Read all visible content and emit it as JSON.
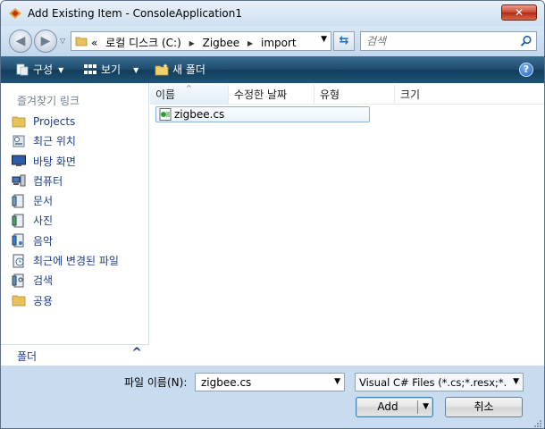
{
  "window": {
    "title": "Add Existing Item - ConsoleApplication1"
  },
  "titlebar": {
    "close_glyph": "✕"
  },
  "address": {
    "overflow": "«",
    "crumbs": [
      "로컬 디스크 (C:)",
      "Zigbee",
      "import"
    ]
  },
  "search": {
    "placeholder": "검색"
  },
  "toolbar": {
    "organize_label": "구성",
    "views_label": "보기",
    "new_folder_label": "새 폴더",
    "help_glyph": "?"
  },
  "nav_pane": {
    "header": "즐겨찾기 링크",
    "items": [
      {
        "label": "Projects",
        "icon": "folder-icon"
      },
      {
        "label": "최근 위치",
        "icon": "recent-places-icon"
      },
      {
        "label": "바탕 화면",
        "icon": "desktop-icon"
      },
      {
        "label": "컴퓨터",
        "icon": "computer-icon"
      },
      {
        "label": "문서",
        "icon": "documents-icon"
      },
      {
        "label": "사진",
        "icon": "pictures-icon"
      },
      {
        "label": "음악",
        "icon": "music-icon"
      },
      {
        "label": "최근에 변경된 파일",
        "icon": "recently-changed-icon"
      },
      {
        "label": "검색",
        "icon": "searches-icon"
      },
      {
        "label": "공용",
        "icon": "public-folder-icon"
      }
    ],
    "folders_label": "폴더"
  },
  "file_list": {
    "columns": {
      "name": "이름",
      "modified": "수정한 날짜",
      "type": "유형",
      "size": "크기"
    },
    "files": [
      {
        "name": "zigbee.cs",
        "icon": "csharp-file-icon"
      }
    ]
  },
  "bottom": {
    "filename_label": "파일 이름(N):",
    "filename_value": "zigbee.cs",
    "filter_value": "Visual C# Files (*.cs;*.resx;*.",
    "add_label": "Add",
    "cancel_label": "취소"
  },
  "colors": {
    "toolbar": "#1d4a6c",
    "link": "#1c3f8c",
    "chrome": "#c9dcef"
  }
}
